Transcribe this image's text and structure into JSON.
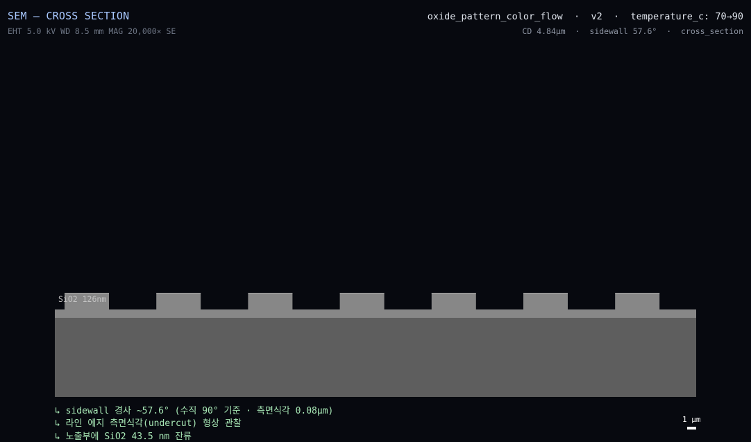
{
  "header": {
    "title": "SEM – CROSS SECTION",
    "imaging_params": "EHT 5.0 kV WD 8.5 mm MAG 20,000× SE",
    "dataset": "oxide_pattern_color_flow",
    "version": "v2",
    "temperature": "temperature_c: 70→90",
    "separator": "·"
  },
  "metrics": {
    "cd": "CD 4.84μm",
    "sidewall": "sidewall 57.6°",
    "view": "cross_section"
  },
  "specimen": {
    "layer_label": "SiO2 126nm",
    "line_count": 7,
    "colors": {
      "background": "#07090f",
      "substrate": "#5e5e5e",
      "oxide": "#878787",
      "line_top": "#a5a5a5"
    }
  },
  "annotations": [
    "↳ sidewall 경사 ~57.6° (수직 90° 기준 · 측면식각 0.08μm)",
    "↳ 라인 에지 측면식각(undercut) 형상 관찰",
    "↳ 노출부에 SiO2 43.5 nm 잔류"
  ],
  "scale_bar": {
    "label": "1 μm"
  }
}
